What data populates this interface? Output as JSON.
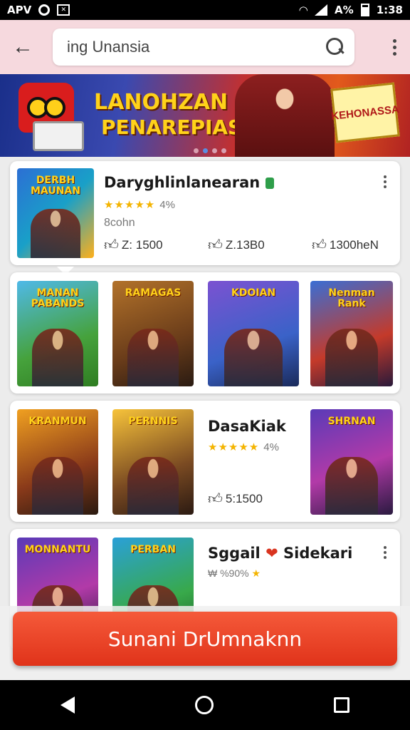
{
  "status_bar": {
    "left_text": "APV",
    "time": "1:38",
    "battery_text": "A%"
  },
  "header": {
    "back_icon": "arrow-left-icon",
    "search_value": "ing Unansia",
    "search_placeholder": "",
    "menu_icon": "more-vert-icon"
  },
  "banner": {
    "title_line1": "LANOHZAN",
    "title_line2": "PENAREPIAS",
    "sign_text": "KEHONASSA",
    "active_dot": 2,
    "dot_count": 4
  },
  "featured": {
    "thumb_text": "DERBH MAUNAN",
    "title": "Daryghlinlanearan",
    "rating_stars": "★★★★★",
    "rating_text": "4%",
    "subtitle": "8cohn",
    "stats": [
      "Z: 1500",
      "Z.13B0",
      "1300heN"
    ]
  },
  "row2": {
    "thumbs": [
      {
        "text": "MANAN PABANDS",
        "color": "t-green"
      },
      {
        "text": "RAMAGAS",
        "color": "t-brown"
      },
      {
        "text": "KDOIAN",
        "color": "t-purple"
      },
      {
        "text": "Nenman Rank",
        "color": "t-red"
      }
    ]
  },
  "row3": {
    "thumb1_text": "KRANMUN",
    "thumb2_text": "PERNNIS",
    "title": "DasaKiak",
    "rating_stars": "★★★★★",
    "rating_text": "4%",
    "stat": "5:1500",
    "thumb3_text": "SHRNAN"
  },
  "row4": {
    "thumb1_text": "MONNANTU",
    "thumb2_text": "PERBAN",
    "title": "Sggail",
    "title_suffix": "Sidekari",
    "rating_text": "₩ %90%",
    "rating_star": "★"
  },
  "cta": {
    "label": "Sunani DrUmnaknn"
  },
  "nav": {
    "back_icon": "nav-back-icon",
    "home_icon": "nav-home-icon",
    "recents_icon": "nav-recents-icon"
  }
}
